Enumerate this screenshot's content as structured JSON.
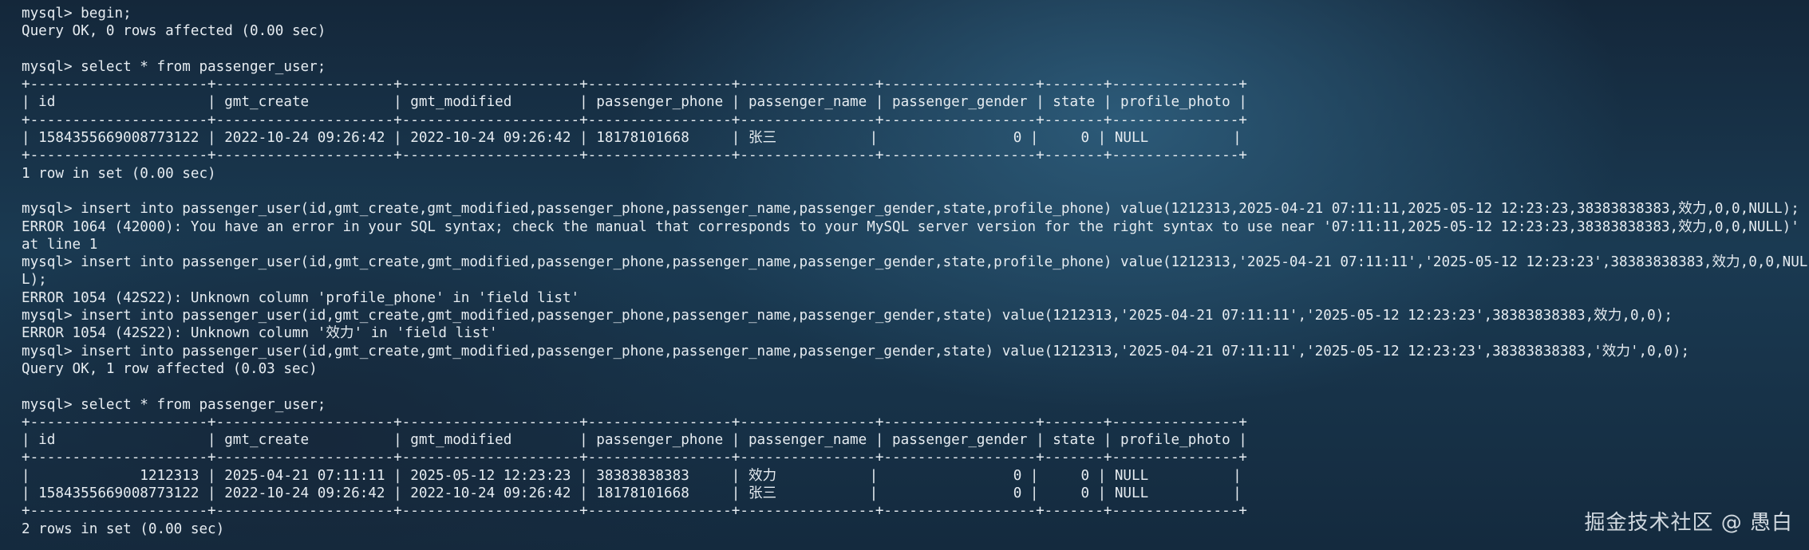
{
  "terminal": {
    "lines": [
      "mysql> begin;",
      "Query OK, 0 rows affected (0.00 sec)",
      "",
      "mysql> select * from passenger_user;",
      "+---------------------+---------------------+---------------------+-----------------+----------------+------------------+-------+---------------+",
      "| id                  | gmt_create          | gmt_modified        | passenger_phone | passenger_name | passenger_gender | state | profile_photo |",
      "+---------------------+---------------------+---------------------+-----------------+----------------+------------------+-------+---------------+",
      "| 1584355669008773122 | 2022-10-24 09:26:42 | 2022-10-24 09:26:42 | 18178101668     | 张三           |                0 |     0 | NULL          |",
      "+---------------------+---------------------+---------------------+-----------------+----------------+------------------+-------+---------------+",
      "1 row in set (0.00 sec)",
      "",
      "mysql> insert into passenger_user(id,gmt_create,gmt_modified,passenger_phone,passenger_name,passenger_gender,state,profile_phone) value(1212313,2025-04-21 07:11:11,2025-05-12 12:23:23,38383838383,效力,0,0,NULL);",
      "ERROR 1064 (42000): You have an error in your SQL syntax; check the manual that corresponds to your MySQL server version for the right syntax to use near '07:11:11,2025-05-12 12:23:23,38383838383,效力,0,0,NULL)'",
      "at line 1",
      "mysql> insert into passenger_user(id,gmt_create,gmt_modified,passenger_phone,passenger_name,passenger_gender,state,profile_phone) value(1212313,'2025-04-21 07:11:11','2025-05-12 12:23:23',38383838383,效力,0,0,NUL",
      "L);",
      "ERROR 1054 (42S22): Unknown column 'profile_phone' in 'field list'",
      "mysql> insert into passenger_user(id,gmt_create,gmt_modified,passenger_phone,passenger_name,passenger_gender,state) value(1212313,'2025-04-21 07:11:11','2025-05-12 12:23:23',38383838383,效力,0,0);",
      "ERROR 1054 (42S22): Unknown column '效力' in 'field list'",
      "mysql> insert into passenger_user(id,gmt_create,gmt_modified,passenger_phone,passenger_name,passenger_gender,state) value(1212313,'2025-04-21 07:11:11','2025-05-12 12:23:23',38383838383,'效力',0,0);",
      "Query OK, 1 row affected (0.03 sec)",
      "",
      "mysql> select * from passenger_user;",
      "+---------------------+---------------------+---------------------+-----------------+----------------+------------------+-------+---------------+",
      "| id                  | gmt_create          | gmt_modified        | passenger_phone | passenger_name | passenger_gender | state | profile_photo |",
      "+---------------------+---------------------+---------------------+-----------------+----------------+------------------+-------+---------------+",
      "|             1212313 | 2025-04-21 07:11:11 | 2025-05-12 12:23:23 | 38383838383     | 效力           |                0 |     0 | NULL          |",
      "| 1584355669008773122 | 2022-10-24 09:26:42 | 2022-10-24 09:26:42 | 18178101668     | 张三           |                0 |     0 | NULL          |",
      "+---------------------+---------------------+---------------------+-----------------+----------------+------------------+-------+---------------+",
      "2 rows in set (0.00 sec)"
    ]
  },
  "watermark": {
    "text": "掘金技术社区 @ 愚白"
  },
  "colors": {
    "text": "#e6ecf1",
    "background": "#1a3a52"
  }
}
